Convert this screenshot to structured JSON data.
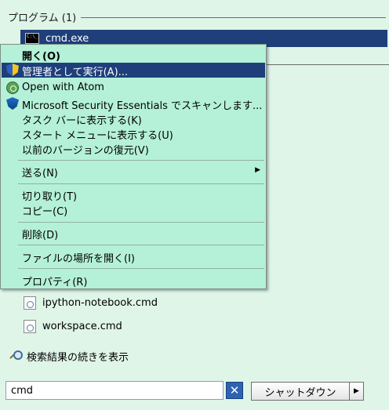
{
  "search_results": {
    "section_header": "プログラム (1)",
    "selected_program": "cmd.exe",
    "files": [
      "ipython-notebook.cmd",
      "workspace.cmd"
    ],
    "more_results_label": "検索結果の続きを表示"
  },
  "context_menu": {
    "items": [
      "開く(O)",
      "管理者として実行(A)...",
      "Open with Atom",
      "Microsoft Security Essentials でスキャンします...",
      "タスク バーに表示する(K)",
      "スタート メニューに表示する(U)",
      "以前のバージョンの復元(V)",
      "送る(N)",
      "切り取り(T)",
      "コピー(C)",
      "削除(D)",
      "ファイルの場所を開く(I)",
      "プロパティ(R)"
    ],
    "submenu_arrow": "▶"
  },
  "bottom_bar": {
    "search_value": "cmd",
    "clear_symbol": "✕",
    "shutdown_label": "シャットダウン",
    "shutdown_arrow": "▶"
  },
  "icons": {
    "program": "cmd-icon",
    "run_as_admin": "shield-icon",
    "atom": "atom-icon",
    "security_essentials": "mse-icon",
    "file": "cmd-file-icon",
    "search": "search-icon"
  },
  "colors": {
    "selection": "#1f3f7a",
    "menu_background": "#b4f1d8",
    "panel_background": "#dff5e8"
  }
}
